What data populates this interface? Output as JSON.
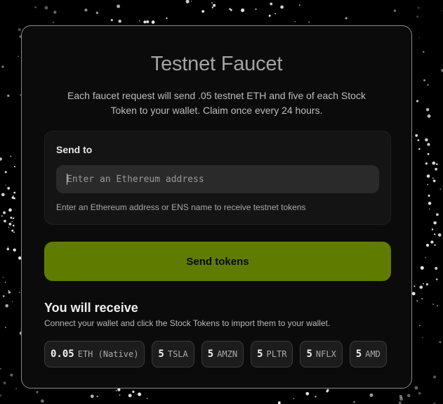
{
  "faucet": {
    "title": "Testnet Faucet",
    "description_line1": "Each faucet request will send .05 testnet ETH and five of each Stock",
    "description_line2": "Token to your wallet. Claim once every 24 hours.",
    "send_to_label": "Send to",
    "address_input": {
      "placeholder": "Enter an Ethereum address",
      "value": ""
    },
    "address_hint": "Enter an Ethereum address or ENS name to receive testnet tokens",
    "send_button_label": "Send tokens",
    "receive_title": "You will receive",
    "receive_description": "Connect your wallet and click the Stock Tokens to import them to your wallet.",
    "tokens": [
      {
        "amount": "0.05",
        "symbol": "ETH (Native)"
      },
      {
        "amount": "5",
        "symbol": "TSLA"
      },
      {
        "amount": "5",
        "symbol": "AMZN"
      },
      {
        "amount": "5",
        "symbol": "PLTR"
      },
      {
        "amount": "5",
        "symbol": "NFLX"
      },
      {
        "amount": "5",
        "symbol": "AMD"
      }
    ]
  },
  "colors": {
    "page_background": "#000000",
    "card_background": "#0b0b0b",
    "card_border": "#8a8a8a",
    "send_button": "#607c00",
    "input_background": "#2a2a2a"
  },
  "background_decoration": "white-particle-dots"
}
